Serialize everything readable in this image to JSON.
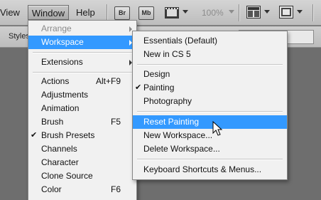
{
  "menubar": {
    "view": "View",
    "window": "Window",
    "help": "Help"
  },
  "toolbar": {
    "br_label": "Br",
    "mb_label": "Mb",
    "zoom": "100%",
    "icons": [
      "bridge-icon",
      "minibridge-icon",
      "film-strip-icon",
      "arrange-documents-icon",
      "screen-mode-icon"
    ]
  },
  "options_bar": {
    "style_label": "Styles"
  },
  "window_menu": {
    "items": [
      {
        "label": "Arrange",
        "shortcut": "",
        "submenu": true,
        "disabled": true,
        "checked": false
      },
      {
        "label": "Workspace",
        "shortcut": "",
        "submenu": true,
        "highlighted": true,
        "checked": false
      },
      {
        "label": "Extensions",
        "shortcut": "",
        "submenu": true,
        "checked": false
      },
      {
        "label": "Actions",
        "shortcut": "Alt+F9",
        "checked": false
      },
      {
        "label": "Adjustments",
        "shortcut": "",
        "checked": false
      },
      {
        "label": "Animation",
        "shortcut": "",
        "checked": false
      },
      {
        "label": "Brush",
        "shortcut": "F5",
        "checked": false
      },
      {
        "label": "Brush Presets",
        "shortcut": "",
        "checked": true
      },
      {
        "label": "Channels",
        "shortcut": "",
        "checked": false
      },
      {
        "label": "Character",
        "shortcut": "",
        "checked": false
      },
      {
        "label": "Clone Source",
        "shortcut": "",
        "checked": false
      },
      {
        "label": "Color",
        "shortcut": "F6",
        "checked": false
      }
    ]
  },
  "workspace_menu": {
    "items": [
      {
        "label": "Essentials (Default)",
        "checked": false
      },
      {
        "label": "New in CS 5",
        "checked": false
      },
      {
        "label": "Design",
        "checked": false
      },
      {
        "label": "Painting",
        "checked": true
      },
      {
        "label": "Photography",
        "checked": false
      },
      {
        "label": "Reset Painting",
        "highlighted": true
      },
      {
        "label": "New Workspace...",
        "checked": false
      },
      {
        "label": "Delete Workspace...",
        "checked": false
      },
      {
        "label": "Keyboard Shortcuts & Menus...",
        "checked": false
      }
    ]
  },
  "colors": {
    "highlight": "#3399ff",
    "menu_bg": "#f1f1f1",
    "canvas_bg": "#6e6e6e"
  }
}
